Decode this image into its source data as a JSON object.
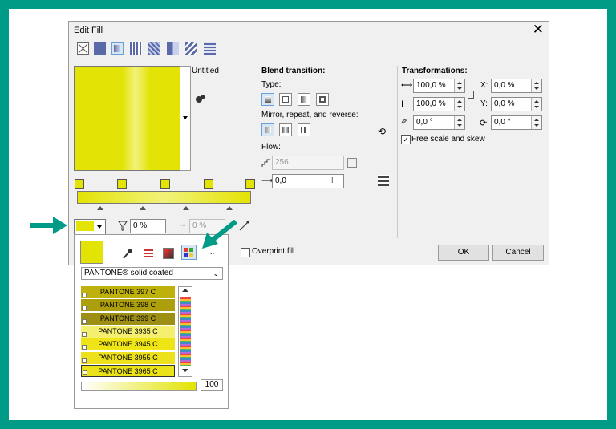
{
  "dialog": {
    "title": "Edit Fill",
    "close_label": "✕",
    "fill_name": "Untitled",
    "blend": {
      "header": "Blend transition:",
      "type_label": "Type:",
      "mirror_label": "Mirror, repeat, and reverse:",
      "flow_label": "Flow:",
      "steps_value": "256",
      "accel_value": "0,0"
    },
    "transform": {
      "header": "Transformations:",
      "width_value": "100,0 %",
      "height_value": "100,0 %",
      "x_label": "X:",
      "x_value": "0,0 %",
      "y_label": "Y:",
      "y_value": "0,0 %",
      "skew_value": "0,0 °",
      "rotate_value": "0,0 °",
      "free_scale_label": "Free scale and skew",
      "free_scale_checked": true
    },
    "opacity_value": "0 %",
    "midpoint_value": "0 %",
    "overprint_label": "Overprint fill",
    "ok_label": "OK",
    "cancel_label": "Cancel"
  },
  "colors": {
    "accent": "#009b86",
    "fill": "#e3e305",
    "fill_light": "#f2f27a"
  },
  "picker": {
    "palette_name": "PANTONE® solid coated",
    "more_label": "...",
    "swatches": [
      {
        "name": "PANTONE 397 C",
        "color": "#bfb10b"
      },
      {
        "name": "PANTONE 398 C",
        "color": "#ac9e0d"
      },
      {
        "name": "PANTONE 399 C",
        "color": "#9c8f14"
      },
      {
        "name": "PANTONE 3935 C",
        "color": "#f5ef70"
      },
      {
        "name": "PANTONE 3945 C",
        "color": "#efe416"
      },
      {
        "name": "PANTONE 3955 C",
        "color": "#ece11b"
      },
      {
        "name": "PANTONE 3965 C",
        "color": "#eae31a"
      }
    ],
    "tint_value": "100"
  }
}
